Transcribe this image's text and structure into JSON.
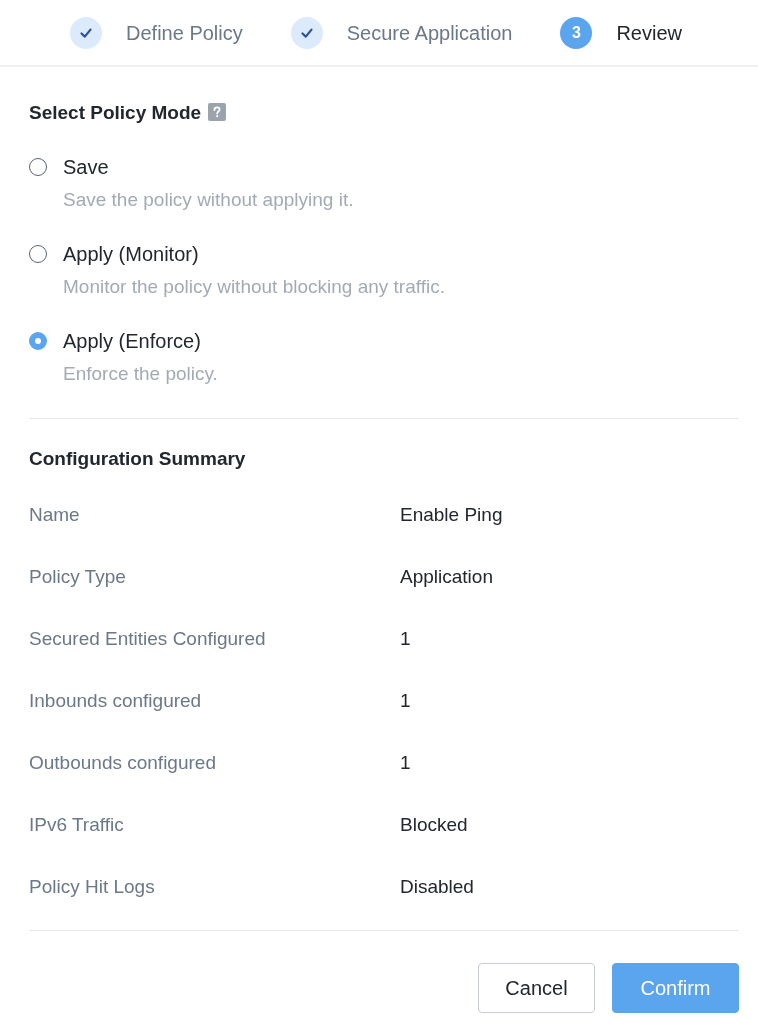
{
  "steps": [
    {
      "label": "Define Policy",
      "completed": true
    },
    {
      "label": "Secure Application",
      "completed": true
    },
    {
      "label": "Review",
      "completed": false,
      "number": "3"
    }
  ],
  "policy_mode": {
    "title": "Select Policy Mode",
    "options": [
      {
        "label": "Save",
        "description": "Save the policy without applying it.",
        "selected": false
      },
      {
        "label": "Apply (Monitor)",
        "description": "Monitor the policy without blocking any traffic.",
        "selected": false
      },
      {
        "label": "Apply (Enforce)",
        "description": "Enforce the policy.",
        "selected": true
      }
    ]
  },
  "summary": {
    "title": "Configuration Summary",
    "rows": [
      {
        "label": "Name",
        "value": "Enable Ping"
      },
      {
        "label": "Policy Type",
        "value": "Application"
      },
      {
        "label": "Secured Entities Configured",
        "value": "1"
      },
      {
        "label": "Inbounds configured",
        "value": "1"
      },
      {
        "label": "Outbounds configured",
        "value": "1"
      },
      {
        "label": "IPv6 Traffic",
        "value": "Blocked"
      },
      {
        "label": "Policy Hit Logs",
        "value": "Disabled"
      }
    ]
  },
  "buttons": [
    {
      "label": "Cancel",
      "kind": "secondary"
    },
    {
      "label": "Confirm",
      "kind": "primary"
    }
  ]
}
